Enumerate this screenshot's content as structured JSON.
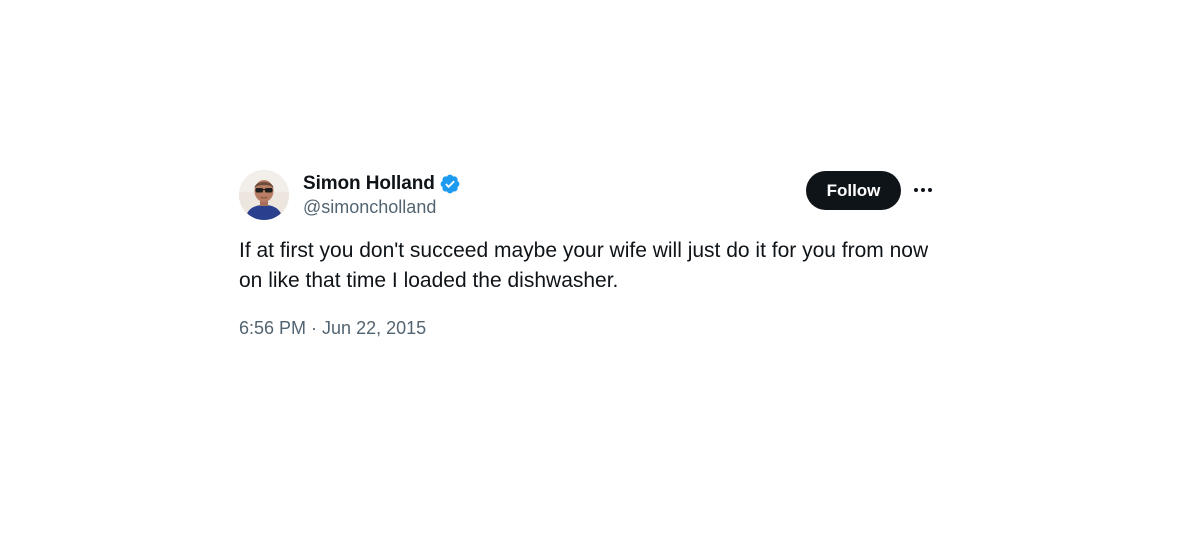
{
  "author": {
    "display_name": "Simon Holland",
    "handle": "@simoncholland",
    "verified": true,
    "avatar_icon": "profile-photo"
  },
  "actions": {
    "follow_label": "Follow",
    "more_icon": "more-horizontal-icon"
  },
  "tweet": {
    "text": "If at first you don't succeed maybe your wife will just do it for you from now on like that time I loaded the dishwasher.",
    "time": "6:56 PM",
    "separator": "·",
    "date": "Jun 22, 2015"
  },
  "colors": {
    "text_primary": "#0f1419",
    "text_secondary": "#536471",
    "verified_blue": "#1d9bf0",
    "button_bg": "#0f1419",
    "button_text": "#ffffff"
  }
}
